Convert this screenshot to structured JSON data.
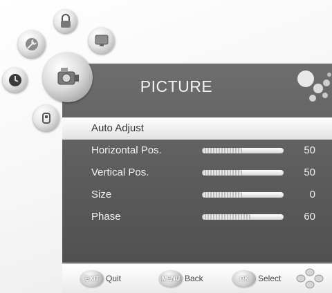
{
  "menu_icons": [
    {
      "name": "lock-icon"
    },
    {
      "name": "tools-icon"
    },
    {
      "name": "screen-icon"
    },
    {
      "name": "clock-icon"
    },
    {
      "name": "picture-camera-icon"
    },
    {
      "name": "usb-icon"
    }
  ],
  "panel": {
    "title": "PICTURE"
  },
  "items": [
    {
      "label": "Auto Adjust",
      "selected": true
    },
    {
      "label": "Horizontal Pos.",
      "value": "50",
      "level": 50,
      "max": 100
    },
    {
      "label": "Vertical Pos.",
      "value": "50",
      "level": 50,
      "max": 100
    },
    {
      "label": "Size",
      "value": "0",
      "level": 50,
      "max": 100
    },
    {
      "label": "Phase",
      "value": "60",
      "level": 60,
      "max": 100
    }
  ],
  "footer": {
    "exit": {
      "key": "EXIT",
      "label": "Quit"
    },
    "menu": {
      "key": "MENU",
      "label": "Back"
    },
    "ok": {
      "key": "OK",
      "label": "Select"
    }
  },
  "colors": {
    "panel": "#5f5f5f",
    "highlight": "#ececec",
    "text": "#f3f3f3"
  }
}
